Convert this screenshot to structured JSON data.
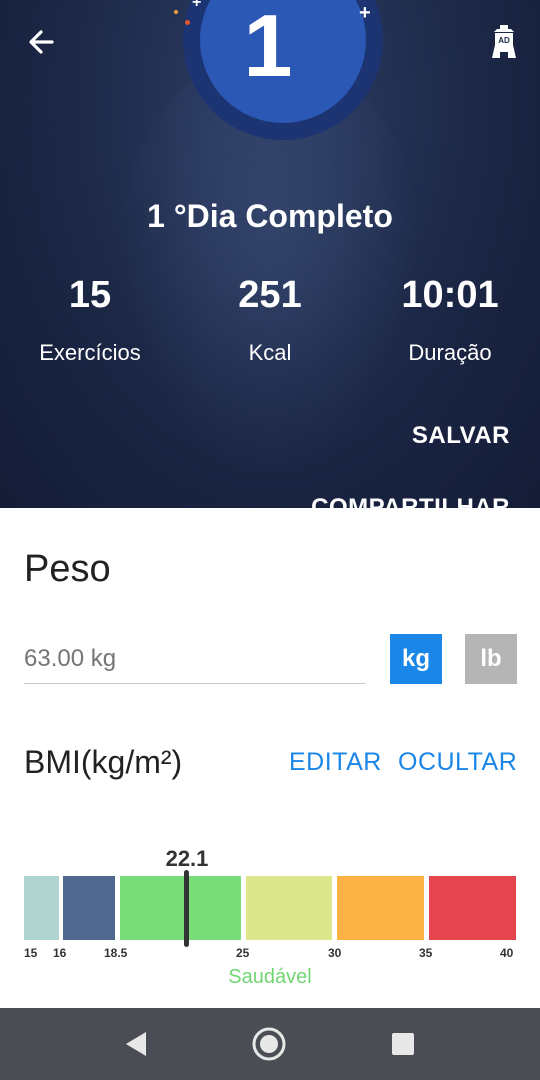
{
  "hero": {
    "day_number": "1",
    "title": "1 °Dia Completo",
    "stats": [
      {
        "value": "15",
        "label": "Exercícios"
      },
      {
        "value": "251",
        "label": "Kcal"
      },
      {
        "value": "10:01",
        "label": "Duração"
      }
    ],
    "save_label": "SALVAR",
    "share_label": "COMPARTILHAR",
    "ad_label": "AD",
    "sparkles": [
      "+",
      "+"
    ],
    "icons": {
      "back": "arrow-left-icon",
      "ad": "ad-tower-icon"
    }
  },
  "weight": {
    "title": "Peso",
    "value": "63.00 kg",
    "unit_kg": "kg",
    "unit_lb": "lb",
    "selected_unit": "kg"
  },
  "bmi": {
    "title": "BMI(kg/m²)",
    "edit_label": "EDITAR",
    "hide_label": "OCULTAR",
    "value": "22.1",
    "status": "Saudável",
    "ticks": [
      "15",
      "16",
      "18.5",
      "25",
      "30",
      "35",
      "40"
    ],
    "segment_colors": [
      "#b0d4cf",
      "#4e6890",
      "#78dc78",
      "#dce68a",
      "#fcb245",
      "#e5454f"
    ]
  },
  "navbar": {
    "icons": [
      "back-triangle-icon",
      "home-circle-icon",
      "recents-square-icon"
    ]
  },
  "colors": {
    "accent": "#1a86e8",
    "hero_bg": "#1c2746",
    "healthy": "#72d672"
  }
}
